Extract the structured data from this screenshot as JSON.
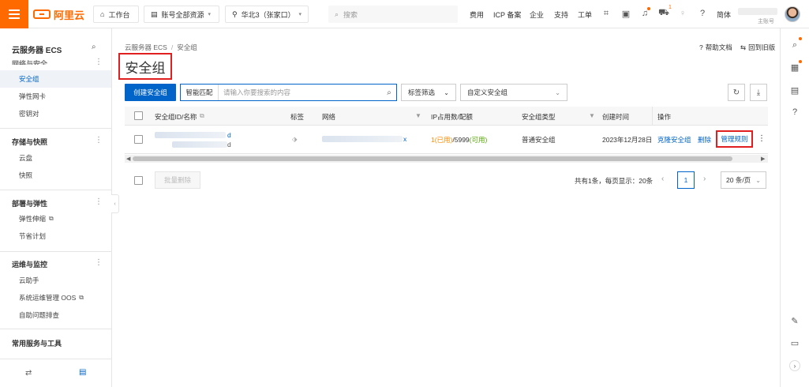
{
  "topbar": {
    "logo_text": "阿里云",
    "workbench": "工作台",
    "account_resources": "账号全部资源",
    "region": "华北3（张家口）",
    "search_placeholder": "搜索",
    "links": [
      "费用",
      "ICP 备案",
      "企业",
      "支持",
      "工单"
    ],
    "cart_badge": "1",
    "language": "简体",
    "user_name": "主账号"
  },
  "sidebar": {
    "title": "云服务器 ECS",
    "sections": [
      {
        "label": "网络与安全",
        "items": [
          {
            "label": "安全组",
            "active": true
          },
          {
            "label": "弹性网卡",
            "active": false
          },
          {
            "label": "密钥对",
            "active": false
          }
        ]
      },
      {
        "label": "存储与快照",
        "items": [
          {
            "label": "云盘",
            "active": false
          },
          {
            "label": "快照",
            "active": false
          }
        ]
      },
      {
        "label": "部署与弹性",
        "items": [
          {
            "label": "弹性伸缩",
            "external": true
          },
          {
            "label": "节省计划",
            "active": false
          }
        ]
      },
      {
        "label": "运维与监控",
        "items": [
          {
            "label": "云助手",
            "active": false
          },
          {
            "label": "系统运维管理 OOS",
            "external": true
          },
          {
            "label": "自助问题排查",
            "active": false
          }
        ]
      },
      {
        "label": "常用服务与工具",
        "items": []
      }
    ]
  },
  "breadcrumb": [
    "云服务器 ECS",
    "安全组"
  ],
  "page_title": "安全组",
  "top_links": {
    "help": "帮助文档",
    "old_version": "回到旧版"
  },
  "toolbar": {
    "create_button": "创建安全组",
    "search_mode": "智能匹配",
    "search_placeholder": "请输入你要搜索的内容",
    "tag_filter": "标签筛选",
    "custom_group": "自定义安全组"
  },
  "table": {
    "headers": [
      "安全组ID/名称",
      "标签",
      "网络",
      "IP占用数/配额",
      "安全组类型",
      "创建时间",
      "操作"
    ],
    "rows": [
      {
        "id_suffix": "d",
        "name_suffix": "d",
        "network_suffix": "x",
        "ip_used": "1(已用)",
        "ip_quota": "/5999",
        "ip_available": "(可用)",
        "type": "普通安全组",
        "created": "2023年12月28日",
        "actions": [
          "克隆安全组",
          "删除",
          "管理规则"
        ]
      }
    ]
  },
  "footer": {
    "batch_delete": "批量删除",
    "summary": "共有1条，每页显示：20条",
    "current_page": "1",
    "page_size": "20 条/页"
  },
  "colors": {
    "accent": "#ff6a00",
    "primary": "#0064c8",
    "highlight_border": "#e02020"
  }
}
